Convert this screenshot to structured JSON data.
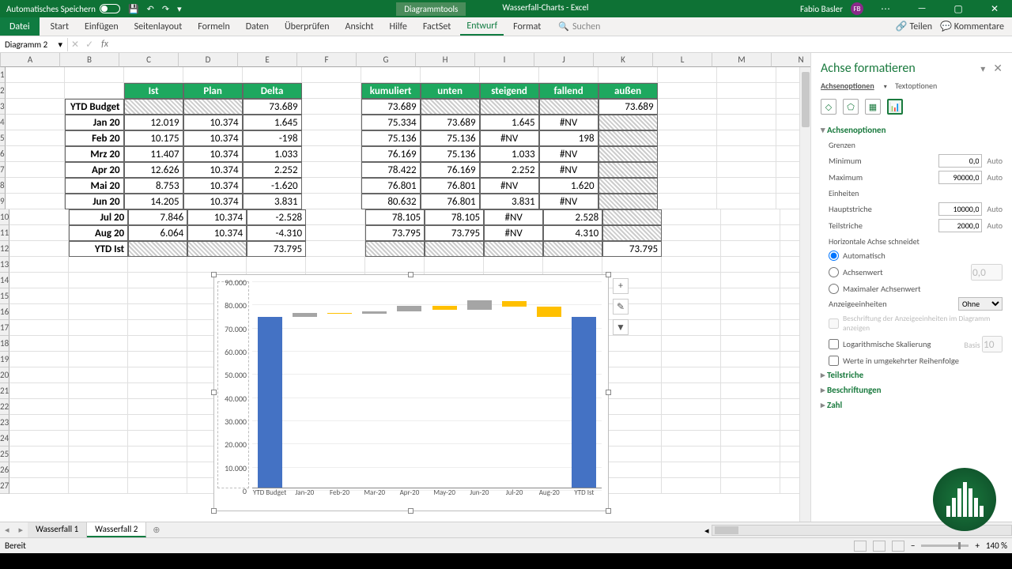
{
  "titlebar": {
    "autosave": "Automatisches Speichern",
    "chart_tools": "Diagrammtools",
    "doc_title": "Wasserfall-Charts - Excel",
    "user": "Fabio Basler",
    "user_initials": "FB"
  },
  "ribbon": {
    "file": "Datei",
    "tabs": [
      "Start",
      "Einfügen",
      "Seitenlayout",
      "Formeln",
      "Daten",
      "Überprüfen",
      "Ansicht",
      "Hilfe",
      "FactSet",
      "Entwurf",
      "Format"
    ],
    "active_tab": "Entwurf",
    "search": "Suchen",
    "share": "Teilen",
    "comments": "Kommentare"
  },
  "fbar": {
    "namebox": "Diagramm 2",
    "formula": ""
  },
  "columns": [
    "A",
    "B",
    "C",
    "D",
    "E",
    "F",
    "G",
    "H",
    "I",
    "J",
    "K",
    "L",
    "M",
    "N"
  ],
  "table1": {
    "headers": [
      "Ist",
      "Plan",
      "Delta"
    ],
    "row_labels": [
      "YTD Budget",
      "Jan 20",
      "Feb 20",
      "Mrz 20",
      "Apr 20",
      "Mai 20",
      "Jun 20",
      "Jul 20",
      "Aug 20",
      "YTD Ist"
    ],
    "data": [
      [
        "hatch",
        "hatch",
        "73.689"
      ],
      [
        "12.019",
        "10.374",
        "1.645"
      ],
      [
        "10.175",
        "10.374",
        "-198"
      ],
      [
        "11.407",
        "10.374",
        "1.033"
      ],
      [
        "12.626",
        "10.374",
        "2.252"
      ],
      [
        "8.753",
        "10.374",
        "-1.620"
      ],
      [
        "14.205",
        "10.374",
        "3.831"
      ],
      [
        "7.846",
        "10.374",
        "-2.528"
      ],
      [
        "6.064",
        "10.374",
        "-4.310"
      ],
      [
        "hatch",
        "hatch",
        "73.795"
      ]
    ]
  },
  "table2": {
    "headers": [
      "kumuliert",
      "unten",
      "steigend",
      "fallend",
      "außen"
    ],
    "data": [
      [
        "73.689",
        "hatch",
        "hatch",
        "hatch",
        "73.689"
      ],
      [
        "75.334",
        "73.689",
        "1.645",
        "#NV",
        "hatch"
      ],
      [
        "75.136",
        "75.136",
        "#NV",
        "198",
        "hatch"
      ],
      [
        "76.169",
        "75.136",
        "1.033",
        "#NV",
        "hatch"
      ],
      [
        "78.422",
        "76.169",
        "2.252",
        "#NV",
        "hatch"
      ],
      [
        "76.801",
        "76.801",
        "#NV",
        "1.620",
        "hatch"
      ],
      [
        "80.632",
        "76.801",
        "3.831",
        "#NV",
        "hatch"
      ],
      [
        "78.105",
        "78.105",
        "#NV",
        "2.528",
        "hatch"
      ],
      [
        "73.795",
        "73.795",
        "#NV",
        "4.310",
        "hatch"
      ],
      [
        "hatch",
        "hatch",
        "hatch",
        "hatch",
        "73.795"
      ]
    ]
  },
  "chart_data": {
    "type": "bar",
    "categories": [
      "YTD Budget",
      "Jan-20",
      "Feb-20",
      "Mar-20",
      "Apr-20",
      "May-20",
      "Jun-20",
      "Jul-20",
      "Aug-20",
      "YTD Ist"
    ],
    "series": [
      {
        "name": "unten",
        "color": "transparent",
        "values": [
          0,
          73689,
          75136,
          75136,
          76169,
          76801,
          76801,
          78105,
          73795,
          0
        ]
      },
      {
        "name": "außen",
        "color": "#4472c4",
        "values": [
          73689,
          0,
          0,
          0,
          0,
          0,
          0,
          0,
          0,
          73795
        ]
      },
      {
        "name": "steigend",
        "color": "#a5a5a5",
        "values": [
          0,
          1645,
          0,
          1033,
          2252,
          0,
          3831,
          0,
          0,
          0
        ]
      },
      {
        "name": "fallend",
        "color": "#ffc000",
        "values": [
          0,
          0,
          198,
          0,
          0,
          1620,
          0,
          2528,
          4310,
          0
        ]
      }
    ],
    "y_ticks": [
      0,
      10000,
      20000,
      30000,
      40000,
      50000,
      60000,
      70000,
      80000,
      90000
    ],
    "y_tick_labels": [
      "0",
      "10.000",
      "20.000",
      "30.000",
      "40.000",
      "50.000",
      "60.000",
      "70.000",
      "80.000",
      "90.000"
    ],
    "ylim": [
      0,
      90000
    ]
  },
  "pane": {
    "title": "Achse formatieren",
    "tabs": {
      "options": "Achsenoptionen",
      "text": "Textoptionen"
    },
    "sec_options": "Achsenoptionen",
    "grenzen": "Grenzen",
    "min_lbl": "Minimum",
    "min_val": "0,0",
    "max_lbl": "Maximum",
    "max_val": "90000,0",
    "einheiten": "Einheiten",
    "haupt_lbl": "Hauptstriche",
    "haupt_val": "10000,0",
    "teil_lbl": "Teilstriche",
    "teil_val": "2000,0",
    "auto": "Auto",
    "horiz": "Horizontale Achse schneidet",
    "r_auto": "Automatisch",
    "r_wert": "Achsenwert",
    "r_wert_val": "0,0",
    "r_max": "Maximaler Achsenwert",
    "anzeige": "Anzeigeeinheiten",
    "anzeige_val": "Ohne",
    "anzeige_note": "Beschriftung der Anzeigeeinheiten im Diagramm anzeigen",
    "log": "Logarithmische Skalierung",
    "basis_lbl": "Basis",
    "basis_val": "10",
    "reverse": "Werte in umgekehrter Reihenfolge",
    "sec_ticks": "Teilstriche",
    "sec_labels": "Beschriftungen",
    "sec_number": "Zahl"
  },
  "sheets": {
    "tabs": [
      "Wasserfall 1",
      "Wasserfall 2"
    ],
    "active": 1
  },
  "status": {
    "ready": "Bereit",
    "zoom": "140 %"
  }
}
